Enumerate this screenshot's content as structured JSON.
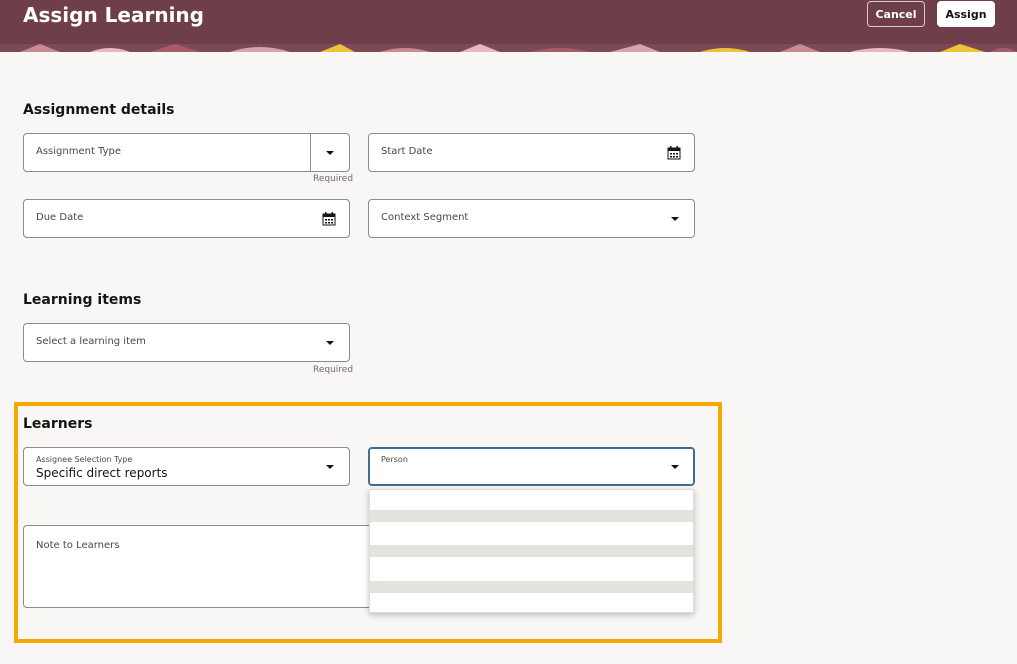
{
  "header": {
    "title": "Assign Learning",
    "cancel_label": "Cancel",
    "assign_label": "Assign"
  },
  "assignment_details": {
    "title": "Assignment details",
    "assignment_type_label": "Assignment Type",
    "required_label": "Required",
    "start_date_label": "Start Date",
    "due_date_label": "Due Date",
    "context_segment_label": "Context Segment"
  },
  "learning_items": {
    "title": "Learning items",
    "placeholder": "Select a learning item",
    "required_label": "Required"
  },
  "learners": {
    "title": "Learners",
    "assignee_selection_type_label": "Assignee Selection Type",
    "assignee_selection_type_value": "Specific direct reports",
    "person_label": "Person",
    "note_label": "Note to Learners"
  },
  "colors": {
    "header_bg": "#6e3f4a",
    "highlight_border": "#f5a800",
    "page_bg": "#f9f7f5"
  }
}
